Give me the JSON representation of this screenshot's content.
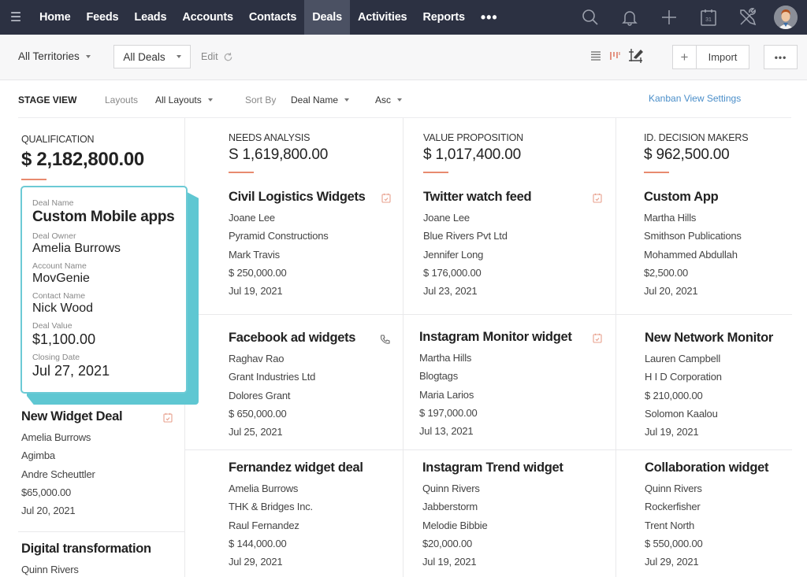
{
  "nav": {
    "items": [
      "Home",
      "Feeds",
      "Leads",
      "Accounts",
      "Contacts",
      "Deals",
      "Activities",
      "Reports"
    ],
    "active": "Deals",
    "more": "•••",
    "icons": [
      "search-icon",
      "bell-icon",
      "plus-icon",
      "calendar-icon",
      "tools-icon",
      "avatar"
    ],
    "calendar_day": "31"
  },
  "toolbar": {
    "territory": "All Territories",
    "view": "All Deals",
    "edit": "Edit",
    "import": "Import",
    "plus": "+",
    "more": "•••"
  },
  "subbar": {
    "stage_view": "STAGE VIEW",
    "layouts_label": "Layouts",
    "layouts_value": "All Layouts",
    "sort_label": "Sort By",
    "sort_value": "Deal Name",
    "order_value": "Asc",
    "kanban_settings": "Kanban View Settings"
  },
  "colors": {
    "nav_bg": "#2c3142",
    "nav_active": "#4b5163",
    "accent_underline": "#e88a6f",
    "drag_border": "#6ccad5",
    "link": "#4a8ec9"
  },
  "stages": [
    {
      "name": "QUALIFICATION",
      "amount": "$ 2,182,800.00",
      "dragging_card": {
        "fields": [
          {
            "label": "Deal Name",
            "value": "Custom Mobile apps"
          },
          {
            "label": "Deal Owner",
            "value": "Amelia Burrows"
          },
          {
            "label": "Account Name",
            "value": "MovGenie"
          },
          {
            "label": "Contact Name",
            "value": "Nick Wood"
          },
          {
            "label": "Deal Value",
            "value": "$1,100.00"
          },
          {
            "label": "Closing Date",
            "value": "Jul 27, 2021"
          }
        ]
      },
      "cards": [
        {
          "title": "New Widget Deal",
          "lines": [
            "Amelia Burrows",
            "Agimba",
            "Andre Scheuttler",
            "$65,000.00",
            "Jul 20, 2021"
          ],
          "icon": "task-icon"
        },
        {
          "title": "Digital transformation",
          "lines": [
            "Quinn Rivers"
          ],
          "icon": ""
        }
      ]
    },
    {
      "name": "NEEDS ANALYSIS",
      "amount": "S 1,619,800.00",
      "cards": [
        {
          "title": "Civil Logistics Widgets",
          "lines": [
            "Joane Lee",
            "Pyramid Constructions",
            "Mark Travis",
            "$ 250,000.00",
            "Jul 19, 2021"
          ],
          "icon": "task-icon"
        },
        {
          "title": "Facebook ad widgets",
          "lines": [
            "Raghav Rao",
            "Grant Industries Ltd",
            "Dolores Grant",
            "$ 650,000.00",
            "Jul 25, 2021"
          ],
          "icon": "phone-icon"
        },
        {
          "title": "Fernandez widget deal",
          "lines": [
            "Amelia Burrows",
            "THK & Bridges Inc.",
            "Raul Fernandez",
            "$ 144,000.00",
            "Jul 29, 2021"
          ],
          "icon": ""
        }
      ]
    },
    {
      "name": "VALUE PROPOSITION",
      "amount": "$ 1,017,400.00",
      "cards": [
        {
          "title": "Twitter watch feed",
          "lines": [
            "Joane Lee",
            "Blue Rivers Pvt Ltd",
            "Jennifer Long",
            "$ 176,000.00",
            "Jul 23, 2021"
          ],
          "icon": "task-icon"
        },
        {
          "title": "Instagram Monitor widget",
          "lines": [
            "Martha Hills",
            "Blogtags",
            "Maria Larios",
            "$ 197,000.00",
            "Jul 13, 2021"
          ],
          "icon": "task-icon"
        },
        {
          "title": "Instagram Trend widget",
          "lines": [
            "Quinn Rivers",
            "Jabberstorm",
            "Melodie Bibbie",
            "$20,000.00",
            "Jul 19, 2021"
          ],
          "icon": ""
        }
      ]
    },
    {
      "name": "ID. DECISION MAKERS",
      "amount": "$ 962,500.00",
      "cards": [
        {
          "title": "Custom App",
          "lines": [
            "Martha Hills",
            "Smithson Publications",
            "Mohammed Abdullah",
            "$2,500.00",
            "Jul 20, 2021"
          ],
          "icon": ""
        },
        {
          "title": "New Network Monitor",
          "lines": [
            "Lauren Campbell",
            "H I D Corporation",
            "$ 210,000.00",
            "Solomon Kaalou",
            "Jul 19, 2021"
          ],
          "icon": ""
        },
        {
          "title": "Collaboration widget",
          "lines": [
            "Quinn Rivers",
            "Rockerfisher",
            "Trent North",
            "$ 550,000.00",
            "Jul 29, 2021"
          ],
          "icon": ""
        }
      ]
    }
  ]
}
